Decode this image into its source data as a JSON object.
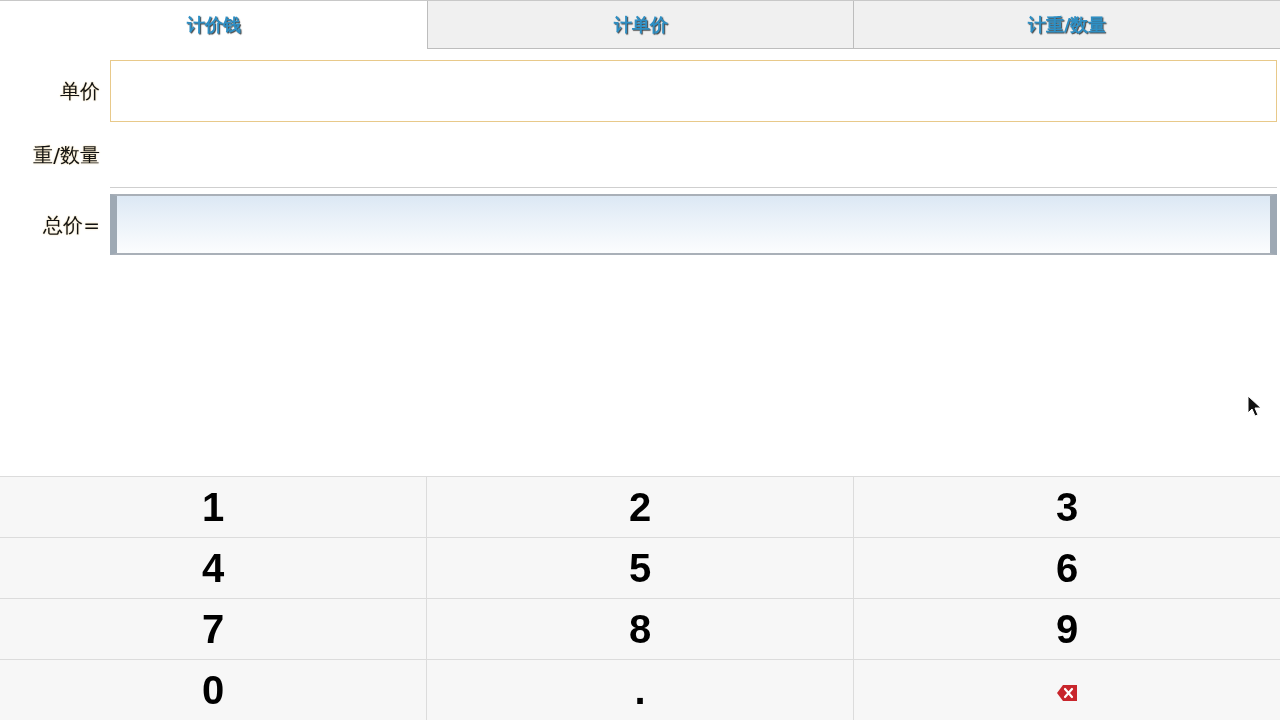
{
  "tabs": [
    {
      "label": "计价钱",
      "selected": true
    },
    {
      "label": "计单价",
      "selected": false
    },
    {
      "label": "计重/数量",
      "selected": false
    }
  ],
  "form": {
    "fields": [
      {
        "label": "单价",
        "kind": "input",
        "focused": true
      },
      {
        "label": "重/数量",
        "kind": "input",
        "focused": false
      },
      {
        "label": "总价=",
        "kind": "result"
      }
    ]
  },
  "keypad": {
    "keys": [
      {
        "kind": "digit",
        "label": "1"
      },
      {
        "kind": "digit",
        "label": "2"
      },
      {
        "kind": "digit",
        "label": "3"
      },
      {
        "kind": "digit",
        "label": "4"
      },
      {
        "kind": "digit",
        "label": "5"
      },
      {
        "kind": "digit",
        "label": "6"
      },
      {
        "kind": "digit",
        "label": "7"
      },
      {
        "kind": "digit",
        "label": "8"
      },
      {
        "kind": "digit",
        "label": "9"
      },
      {
        "kind": "digit",
        "label": "0"
      },
      {
        "kind": "digit",
        "label": "."
      },
      {
        "kind": "backspace"
      }
    ]
  }
}
